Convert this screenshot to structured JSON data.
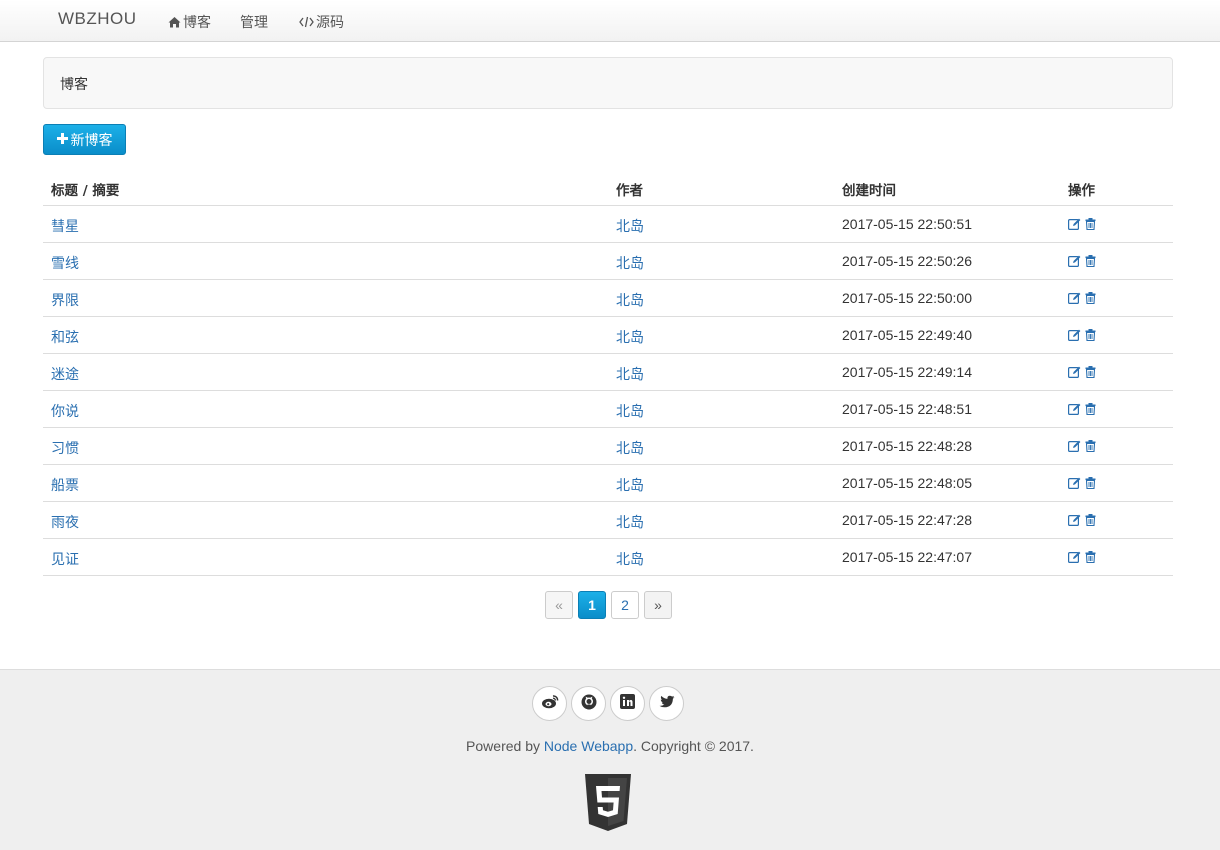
{
  "nav": {
    "brand": "WBZHOU",
    "items": [
      {
        "label": "博客",
        "icon": "home-icon"
      },
      {
        "label": "管理",
        "icon": ""
      },
      {
        "label": "源码",
        "icon": "code-icon"
      }
    ]
  },
  "breadcrumb": {
    "current": "博客"
  },
  "toolbar": {
    "new_label": "新博客",
    "icon": "plus-icon"
  },
  "table": {
    "headers": [
      "标题 / 摘要",
      "作者",
      "创建时间",
      "操作"
    ],
    "rows": [
      {
        "title": "彗星",
        "author": "北岛",
        "created": "2017-05-15 22:50:51"
      },
      {
        "title": "雪线",
        "author": "北岛",
        "created": "2017-05-15 22:50:26"
      },
      {
        "title": "界限",
        "author": "北岛",
        "created": "2017-05-15 22:50:00"
      },
      {
        "title": "和弦",
        "author": "北岛",
        "created": "2017-05-15 22:49:40"
      },
      {
        "title": "迷途",
        "author": "北岛",
        "created": "2017-05-15 22:49:14"
      },
      {
        "title": "你说",
        "author": "北岛",
        "created": "2017-05-15 22:48:51"
      },
      {
        "title": "习惯",
        "author": "北岛",
        "created": "2017-05-15 22:48:28"
      },
      {
        "title": "船票",
        "author": "北岛",
        "created": "2017-05-15 22:48:05"
      },
      {
        "title": "雨夜",
        "author": "北岛",
        "created": "2017-05-15 22:47:28"
      },
      {
        "title": "见证",
        "author": "北岛",
        "created": "2017-05-15 22:47:07"
      }
    ],
    "row_actions": [
      "edit-icon",
      "trash-icon"
    ]
  },
  "pagination": {
    "prev": "«",
    "pages": [
      "1",
      "2"
    ],
    "current": "1",
    "next": "»"
  },
  "footer": {
    "socials": [
      "weibo-icon",
      "github-icon",
      "linkedin-icon",
      "twitter-icon"
    ],
    "powered_prefix": "Powered by ",
    "powered_link": "Node Webapp",
    "powered_suffix": ". Copyright © 2017.",
    "badge": "html5-logo"
  },
  "colors": {
    "accent": "#0a8dc9",
    "link": "#2a6fb0",
    "footer_bg": "#efefef"
  }
}
